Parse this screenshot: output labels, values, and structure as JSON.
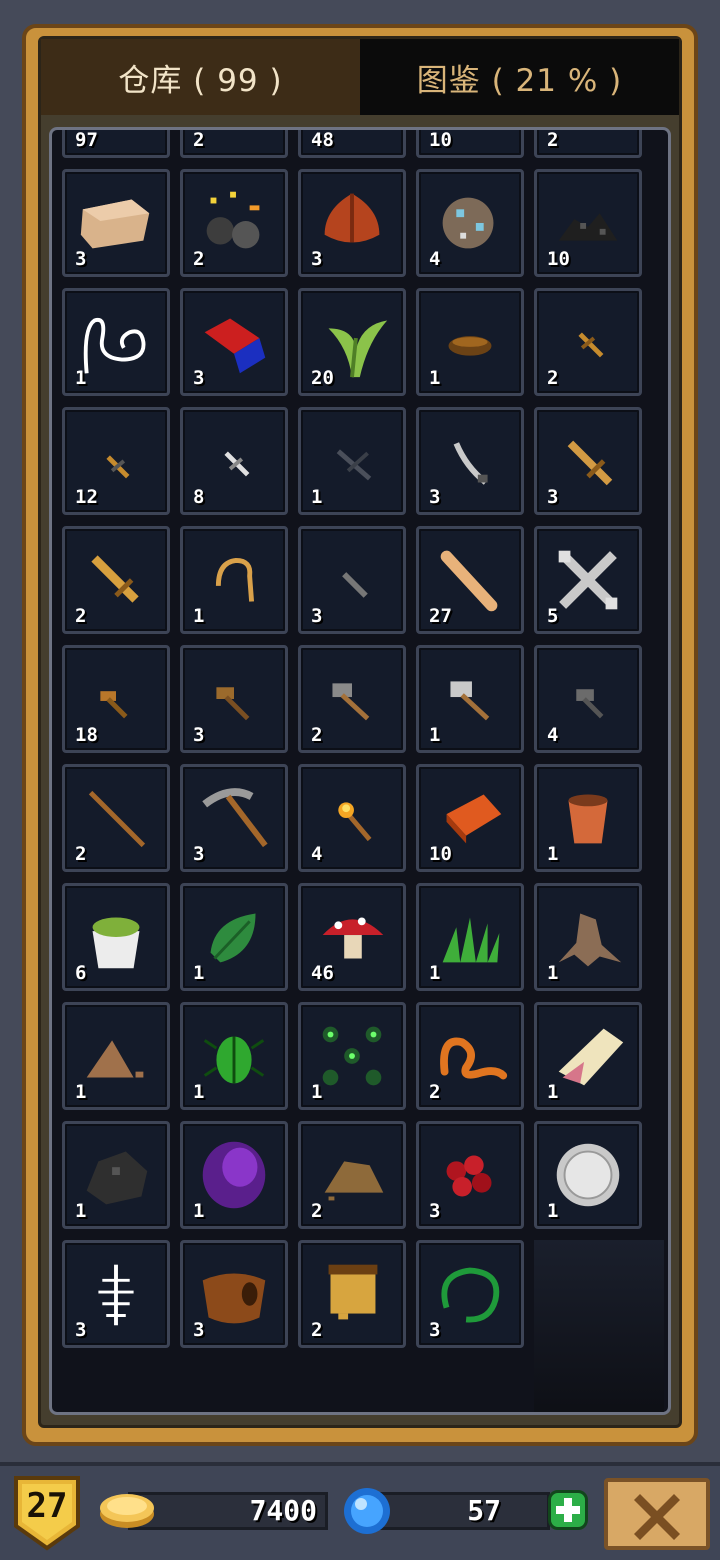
{
  "tabs": {
    "warehouse": "仓库 ( 99 )",
    "codex": "图鉴 ( 21 % )"
  },
  "inventory": [
    {
      "icon": "stone-ingot-icon",
      "count": "97"
    },
    {
      "icon": "iron-ingot-icon",
      "count": "2"
    },
    {
      "icon": "silver-ingot-icon",
      "count": "48"
    },
    {
      "icon": "crystal-ore-icon",
      "count": "10"
    },
    {
      "icon": "copper-ore-icon",
      "count": "2"
    },
    {
      "icon": "sand-block-icon",
      "count": "3"
    },
    {
      "icon": "coal-sparks-icon",
      "count": "2"
    },
    {
      "icon": "red-seed-icon",
      "count": "3"
    },
    {
      "icon": "gem-ore-icon",
      "count": "4"
    },
    {
      "icon": "coal-pile-icon",
      "count": "10"
    },
    {
      "icon": "rope-icon",
      "count": "1"
    },
    {
      "icon": "magnet-icon",
      "count": "3"
    },
    {
      "icon": "herb-icon",
      "count": "20"
    },
    {
      "icon": "bowl-icon",
      "count": "1"
    },
    {
      "icon": "tiny-dagger-icon",
      "count": "2"
    },
    {
      "icon": "bronze-dagger-icon",
      "count": "12"
    },
    {
      "icon": "silver-dagger-icon",
      "count": "8"
    },
    {
      "icon": "dark-dagger-icon",
      "count": "1"
    },
    {
      "icon": "curved-blade-icon",
      "count": "3"
    },
    {
      "icon": "wooden-sword-icon",
      "count": "3"
    },
    {
      "icon": "golden-sword-icon",
      "count": "2"
    },
    {
      "icon": "hook-icon",
      "count": "1"
    },
    {
      "icon": "iron-knife-icon",
      "count": "3"
    },
    {
      "icon": "wooden-club-icon",
      "count": "27"
    },
    {
      "icon": "crossed-wrench-icon",
      "count": "5"
    },
    {
      "icon": "bronze-hammer-icon",
      "count": "18"
    },
    {
      "icon": "wood-hammer-icon",
      "count": "3"
    },
    {
      "icon": "iron-hammer-icon",
      "count": "2"
    },
    {
      "icon": "steel-hammer-icon",
      "count": "1"
    },
    {
      "icon": "dark-hammer-icon",
      "count": "4"
    },
    {
      "icon": "stick-icon",
      "count": "2"
    },
    {
      "icon": "pickaxe-icon",
      "count": "3"
    },
    {
      "icon": "torch-icon",
      "count": "4"
    },
    {
      "icon": "brick-icon",
      "count": "10"
    },
    {
      "icon": "clay-pot-icon",
      "count": "1"
    },
    {
      "icon": "potted-moss-icon",
      "count": "6"
    },
    {
      "icon": "leaf-icon",
      "count": "1"
    },
    {
      "icon": "mushroom-icon",
      "count": "46"
    },
    {
      "icon": "grass-icon",
      "count": "1"
    },
    {
      "icon": "tree-root-icon",
      "count": "1"
    },
    {
      "icon": "dirt-pile-icon",
      "count": "1"
    },
    {
      "icon": "green-beetle-icon",
      "count": "1"
    },
    {
      "icon": "bug-swarm-icon",
      "count": "1"
    },
    {
      "icon": "worm-icon",
      "count": "2"
    },
    {
      "icon": "bone-icon",
      "count": "1"
    },
    {
      "icon": "coal-chunk-icon",
      "count": "1"
    },
    {
      "icon": "purple-egg-icon",
      "count": "1"
    },
    {
      "icon": "dust-pile-icon",
      "count": "2"
    },
    {
      "icon": "red-berries-icon",
      "count": "3"
    },
    {
      "icon": "silver-coin-icon",
      "count": "1"
    },
    {
      "icon": "skeleton-fish-icon",
      "count": "3"
    },
    {
      "icon": "leather-pouch-icon",
      "count": "3"
    },
    {
      "icon": "scroll-icon",
      "count": "2"
    },
    {
      "icon": "green-snake-icon",
      "count": "3"
    }
  ],
  "footer": {
    "level": "27",
    "gold": "7400",
    "gems": "57"
  },
  "colors": {
    "frame_gold": "#c9923c",
    "cell_bg": "#141b2a",
    "cell_border": "#3d4456",
    "plus_green": "#2cae47"
  }
}
